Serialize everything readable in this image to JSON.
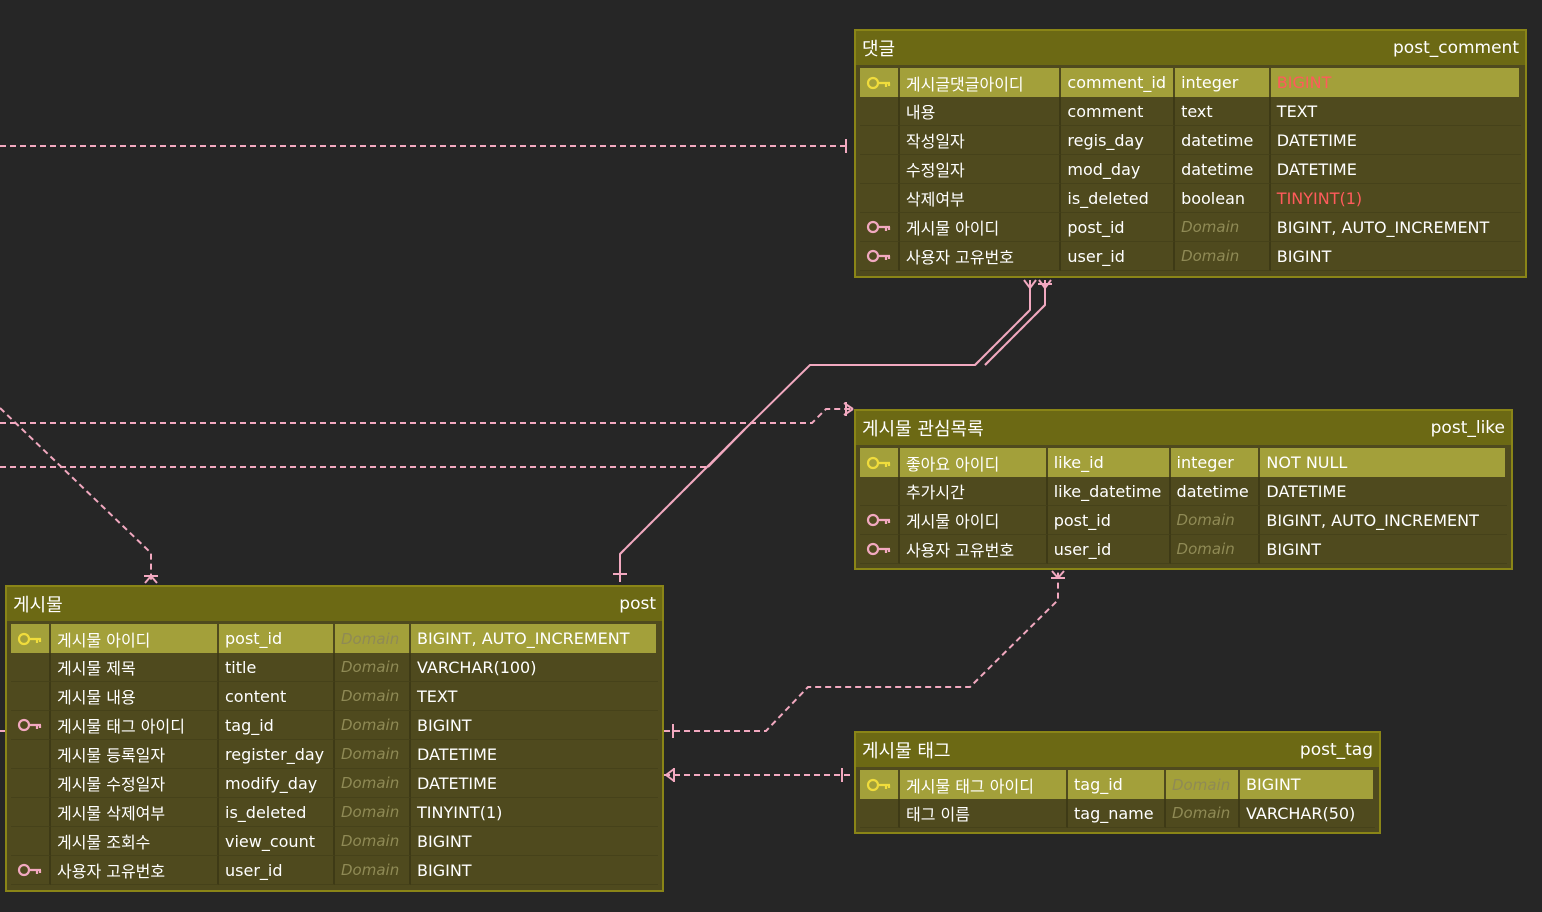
{
  "colors": {
    "background": "#262626",
    "entity_body": "#4f4a1e",
    "entity_header": "#6c6914",
    "entity_border": "#8a8517",
    "pk_row": "#a3a03a",
    "connector": "#f2a9c0",
    "warning_text": "#ff5b5b",
    "pk_key_icon": "#f0dc3c",
    "fk_key_icon": "#f2a9c0"
  },
  "icons": {
    "primary_key": "key-icon",
    "foreign_key": "key-outline-icon"
  },
  "entities": {
    "post_comment": {
      "logical": "댓글",
      "physical": "post_comment",
      "rows": [
        {
          "key": "pk",
          "logical": "게시글댓글아이디",
          "physical": "comment_id",
          "domain": "integer",
          "type": "BIGINT",
          "type_warn": true
        },
        {
          "key": "",
          "logical": "내용",
          "physical": "comment",
          "domain": "text",
          "type": "TEXT"
        },
        {
          "key": "",
          "logical": "작성일자",
          "physical": "regis_day",
          "domain": "datetime",
          "type": "DATETIME"
        },
        {
          "key": "",
          "logical": "수정일자",
          "physical": "mod_day",
          "domain": "datetime",
          "type": "DATETIME"
        },
        {
          "key": "",
          "logical": "삭제여부",
          "physical": "is_deleted",
          "domain": "boolean",
          "type": "TINYINT(1)",
          "type_warn": true
        },
        {
          "key": "fk",
          "logical": "게시물 아이디",
          "physical": "post_id",
          "domain": "Domain",
          "domain_placeholder": true,
          "type": "BIGINT, AUTO_INCREMENT"
        },
        {
          "key": "fk",
          "logical": "사용자 고유번호",
          "physical": "user_id",
          "domain": "Domain",
          "domain_placeholder": true,
          "type": "BIGINT"
        }
      ]
    },
    "post_like": {
      "logical": "게시물 관심목록",
      "physical": "post_like",
      "rows": [
        {
          "key": "pk",
          "logical": "좋아요 아이디",
          "physical": "like_id",
          "domain": "integer",
          "type": "NOT NULL"
        },
        {
          "key": "",
          "logical": "추가시간",
          "physical": "like_datetime",
          "domain": "datetime",
          "type": "DATETIME"
        },
        {
          "key": "fk",
          "logical": "게시물 아이디",
          "physical": "post_id",
          "domain": "Domain",
          "domain_placeholder": true,
          "type": "BIGINT, AUTO_INCREMENT"
        },
        {
          "key": "fk",
          "logical": "사용자 고유번호",
          "physical": "user_id",
          "domain": "Domain",
          "domain_placeholder": true,
          "type": "BIGINT"
        }
      ]
    },
    "post": {
      "logical": "게시물",
      "physical": "post",
      "rows": [
        {
          "key": "pk",
          "logical": "게시물 아이디",
          "physical": "post_id",
          "domain": "Domain",
          "domain_placeholder": true,
          "type": "BIGINT, AUTO_INCREMENT"
        },
        {
          "key": "",
          "logical": "게시물 제목",
          "physical": "title",
          "domain": "Domain",
          "domain_placeholder": true,
          "type": "VARCHAR(100)"
        },
        {
          "key": "",
          "logical": "게시물 내용",
          "physical": "content",
          "domain": "Domain",
          "domain_placeholder": true,
          "type": "TEXT"
        },
        {
          "key": "fk",
          "logical": "게시물 태그 아이디",
          "physical": "tag_id",
          "domain": "Domain",
          "domain_placeholder": true,
          "type": "BIGINT"
        },
        {
          "key": "",
          "logical": "게시물 등록일자",
          "physical": "register_day",
          "domain": "Domain",
          "domain_placeholder": true,
          "type": "DATETIME"
        },
        {
          "key": "",
          "logical": "게시물 수정일자",
          "physical": "modify_day",
          "domain": "Domain",
          "domain_placeholder": true,
          "type": "DATETIME"
        },
        {
          "key": "",
          "logical": "게시물 삭제여부",
          "physical": "is_deleted",
          "domain": "Domain",
          "domain_placeholder": true,
          "type": "TINYINT(1)"
        },
        {
          "key": "",
          "logical": "게시물 조회수",
          "physical": "view_count",
          "domain": "Domain",
          "domain_placeholder": true,
          "type": "BIGINT"
        },
        {
          "key": "fk",
          "logical": "사용자 고유번호",
          "physical": "user_id",
          "domain": "Domain",
          "domain_placeholder": true,
          "type": "BIGINT"
        }
      ]
    },
    "post_tag": {
      "logical": "게시물 태그",
      "physical": "post_tag",
      "rows": [
        {
          "key": "pk",
          "logical": "게시물 태그 아이디",
          "physical": "tag_id",
          "domain": "Domain",
          "domain_placeholder": true,
          "type": "BIGINT"
        },
        {
          "key": "",
          "logical": "태그 이름",
          "physical": "tag_name",
          "domain": "Domain",
          "domain_placeholder": true,
          "type": "VARCHAR(50)"
        }
      ]
    }
  }
}
